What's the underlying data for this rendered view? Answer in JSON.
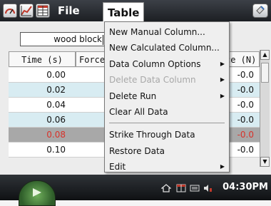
{
  "menubar": {
    "file_label": "File",
    "table_label": "Table"
  },
  "run_name": "wood block",
  "table": {
    "headers": [
      "Time (s)",
      "Force",
      "ce (N)"
    ],
    "rows": [
      {
        "time": "0.00",
        "force": "-0.0",
        "bg": "#ffffff",
        "color": "#111111"
      },
      {
        "time": "0.02",
        "force": "-0.0",
        "bg": "#d8ecf2",
        "color": "#111111"
      },
      {
        "time": "0.04",
        "force": "-0.0",
        "bg": "#ffffff",
        "color": "#111111"
      },
      {
        "time": "0.06",
        "force": "-0.0",
        "bg": "#d8ecf2",
        "color": "#111111"
      },
      {
        "time": "0.08",
        "force": "-0.0",
        "bg": "#a8a8a8",
        "color": "#d8322a"
      },
      {
        "time": "0.10",
        "force": "-0.0",
        "bg": "#ffffff",
        "color": "#111111"
      }
    ]
  },
  "menu": {
    "items": [
      {
        "label": "New Manual Column...",
        "disabled": false,
        "submenu": false
      },
      {
        "label": "New Calculated Column...",
        "disabled": false,
        "submenu": false
      },
      {
        "label": "Data Column Options",
        "disabled": false,
        "submenu": true
      },
      {
        "label": "Delete Data Column",
        "disabled": true,
        "submenu": true
      },
      {
        "label": "Delete Run",
        "disabled": false,
        "submenu": true
      },
      {
        "label": "Clear All Data",
        "disabled": false,
        "submenu": false
      },
      {
        "label": "Strike Through Data",
        "disabled": false,
        "submenu": false
      },
      {
        "label": "Restore Data",
        "disabled": false,
        "submenu": false
      },
      {
        "label": "Edit",
        "disabled": false,
        "submenu": true
      }
    ]
  },
  "status": {
    "clock": "04:30PM"
  },
  "colors": {
    "selected_row": "#a8a8a8",
    "struck_text": "#d8322a",
    "alt_row": "#d8ecf2"
  }
}
